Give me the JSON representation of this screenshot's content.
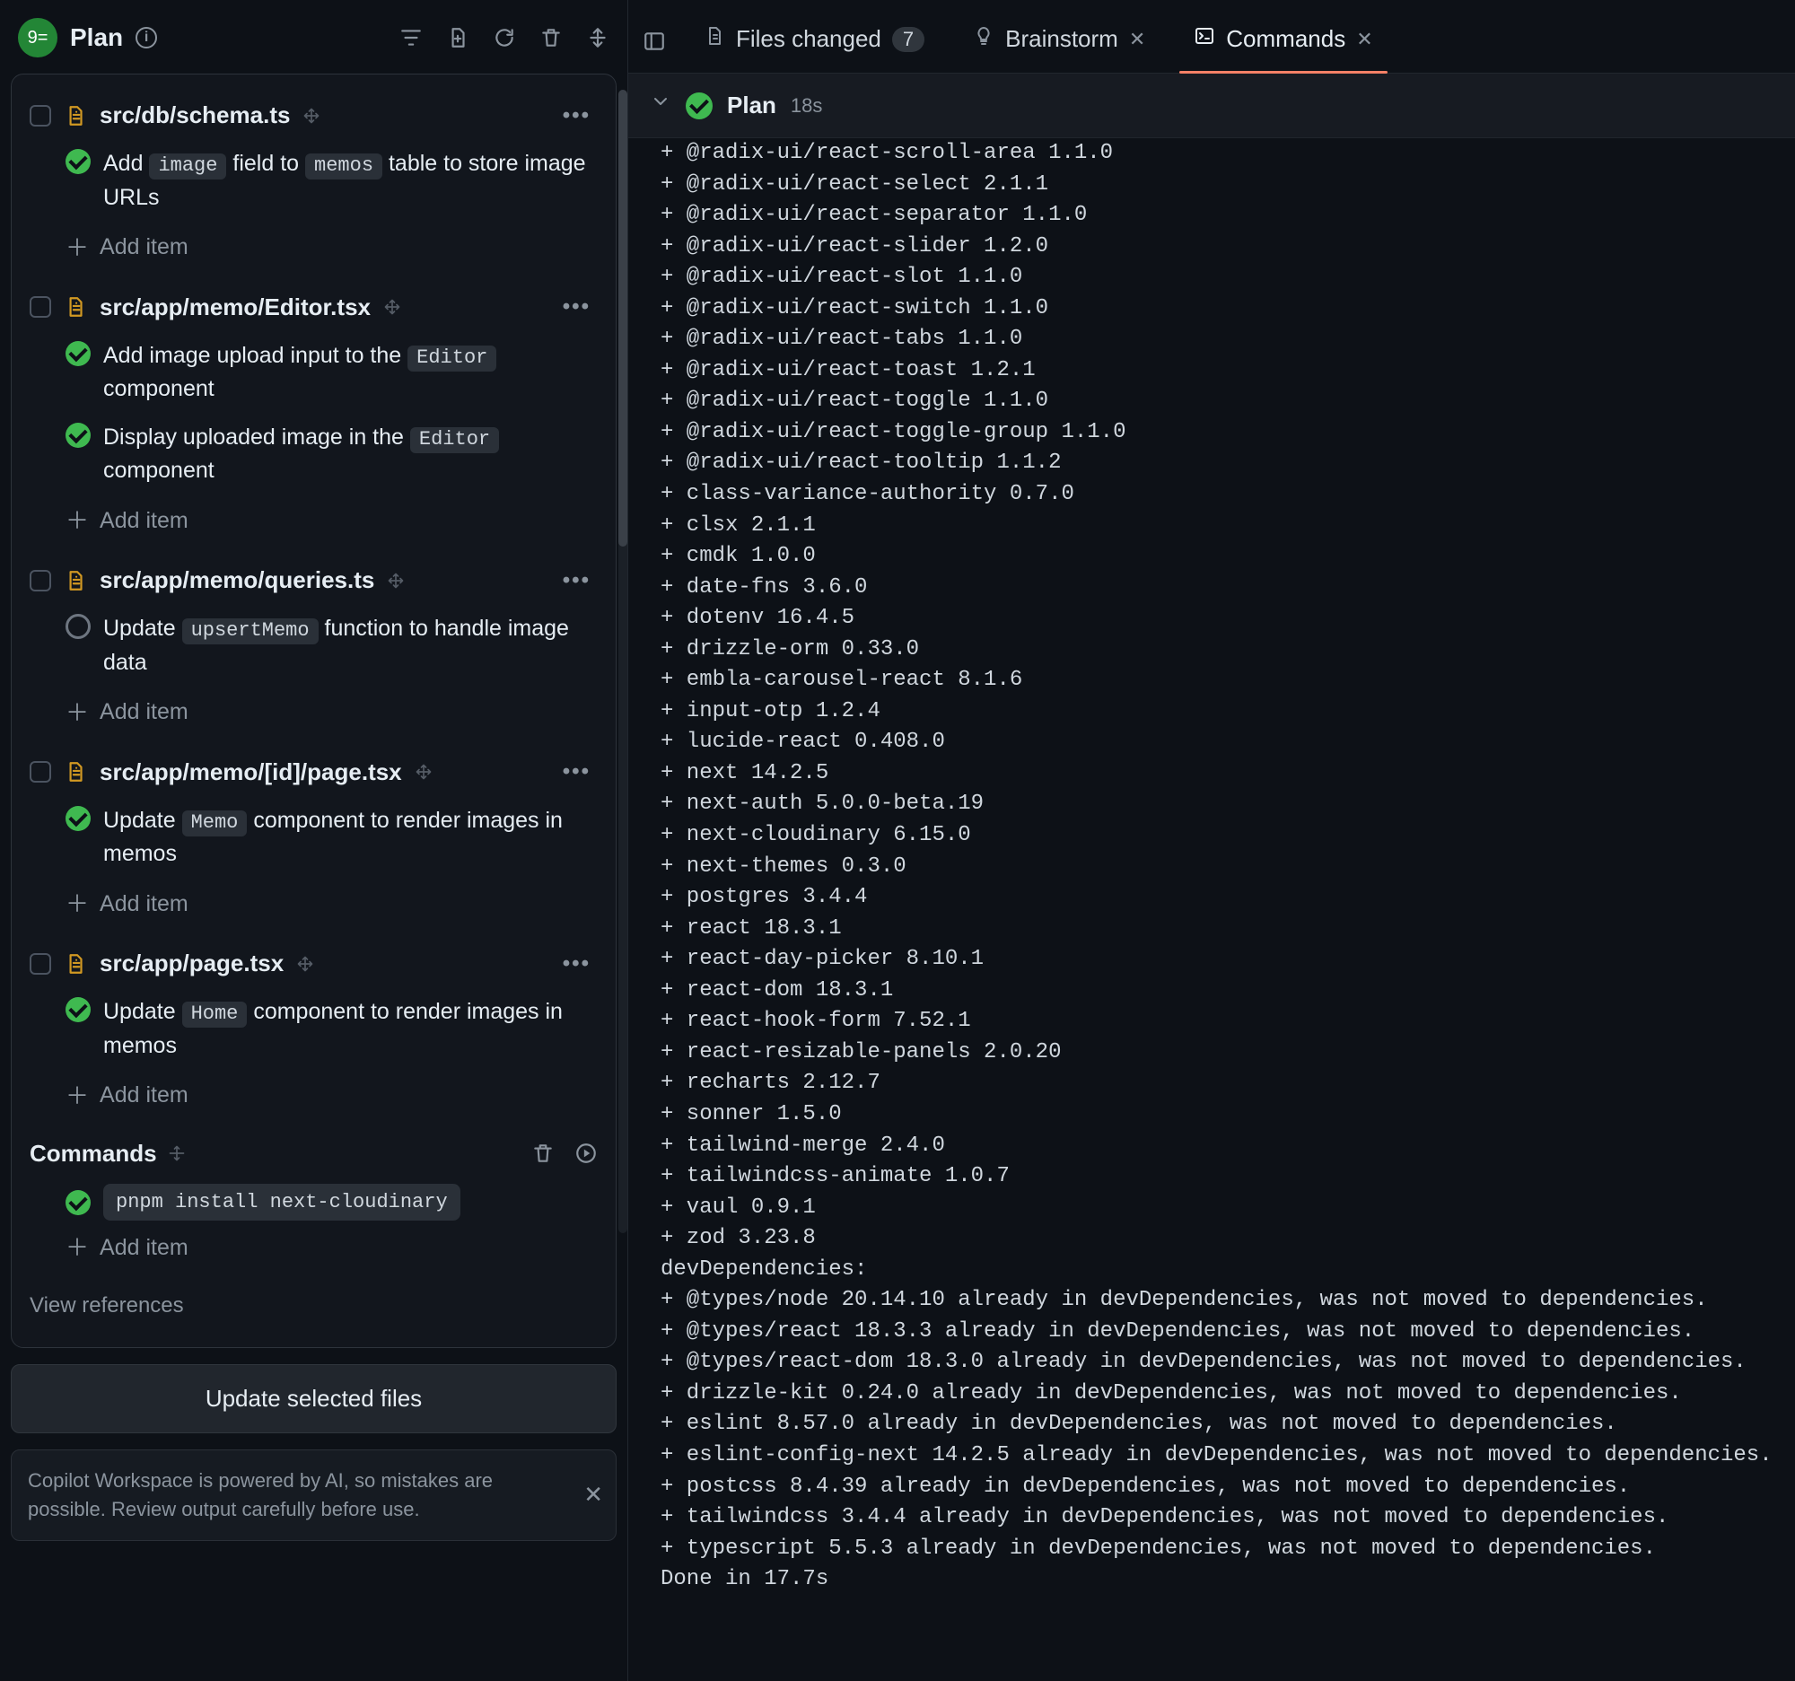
{
  "header": {
    "avatar_text": "9=",
    "title": "Plan"
  },
  "plan": {
    "groups": [
      {
        "path": "src/db/schema.ts",
        "tasks": [
          {
            "status": "done",
            "segments": [
              "Add ",
              {
                "code": "image"
              },
              " field to ",
              {
                "code": "memos"
              },
              " table to store image URLs"
            ]
          }
        ]
      },
      {
        "path": "src/app/memo/Editor.tsx",
        "tasks": [
          {
            "status": "done",
            "segments": [
              "Add image upload input to the ",
              {
                "code": "Editor"
              },
              " component"
            ]
          },
          {
            "status": "done",
            "segments": [
              "Display uploaded image in the ",
              {
                "code": "Editor"
              },
              " component"
            ]
          }
        ]
      },
      {
        "path": "src/app/memo/queries.ts",
        "tasks": [
          {
            "status": "pending",
            "segments": [
              "Update ",
              {
                "code": "upsertMemo"
              },
              " function to handle image data"
            ]
          }
        ]
      },
      {
        "path": "src/app/memo/[id]/page.tsx",
        "tasks": [
          {
            "status": "done",
            "segments": [
              "Update ",
              {
                "code": "Memo"
              },
              " component to render images in memos"
            ]
          }
        ]
      },
      {
        "path": "src/app/page.tsx",
        "tasks": [
          {
            "status": "done",
            "segments": [
              "Update ",
              {
                "code": "Home"
              },
              " component to render images in memos"
            ]
          }
        ]
      }
    ],
    "add_item_label": "Add item",
    "commands": {
      "title": "Commands",
      "items": [
        {
          "status": "done",
          "cmd": "pnpm install next-cloudinary"
        }
      ]
    },
    "view_references": "View references",
    "update_button": "Update selected files"
  },
  "notice": {
    "text": "Copilot Workspace is powered by AI, so mistakes are possible. Review output carefully before use."
  },
  "tabs": {
    "files_changed": {
      "label": "Files changed",
      "count": "7"
    },
    "brainstorm": {
      "label": "Brainstorm"
    },
    "commands": {
      "label": "Commands"
    }
  },
  "subheader": {
    "title": "Plan",
    "time": "18s"
  },
  "terminal_lines": [
    "+ @radix-ui/react-scroll-area 1.1.0",
    "+ @radix-ui/react-select 2.1.1",
    "+ @radix-ui/react-separator 1.1.0",
    "+ @radix-ui/react-slider 1.2.0",
    "+ @radix-ui/react-slot 1.1.0",
    "+ @radix-ui/react-switch 1.1.0",
    "+ @radix-ui/react-tabs 1.1.0",
    "+ @radix-ui/react-toast 1.2.1",
    "+ @radix-ui/react-toggle 1.1.0",
    "+ @radix-ui/react-toggle-group 1.1.0",
    "+ @radix-ui/react-tooltip 1.1.2",
    "+ class-variance-authority 0.7.0",
    "+ clsx 2.1.1",
    "+ cmdk 1.0.0",
    "+ date-fns 3.6.0",
    "+ dotenv 16.4.5",
    "+ drizzle-orm 0.33.0",
    "+ embla-carousel-react 8.1.6",
    "+ input-otp 1.2.4",
    "+ lucide-react 0.408.0",
    "+ next 14.2.5",
    "+ next-auth 5.0.0-beta.19",
    "+ next-cloudinary 6.15.0",
    "+ next-themes 0.3.0",
    "+ postgres 3.4.4",
    "+ react 18.3.1",
    "+ react-day-picker 8.10.1",
    "+ react-dom 18.3.1",
    "+ react-hook-form 7.52.1",
    "+ react-resizable-panels 2.0.20",
    "+ recharts 2.12.7",
    "+ sonner 1.5.0",
    "+ tailwind-merge 2.4.0",
    "+ tailwindcss-animate 1.0.7",
    "+ vaul 0.9.1",
    "+ zod 3.23.8",
    "",
    "devDependencies:",
    "+ @types/node 20.14.10 already in devDependencies, was not moved to dependencies.",
    "+ @types/react 18.3.3 already in devDependencies, was not moved to dependencies.",
    "+ @types/react-dom 18.3.0 already in devDependencies, was not moved to dependencies.",
    "+ drizzle-kit 0.24.0 already in devDependencies, was not moved to dependencies.",
    "+ eslint 8.57.0 already in devDependencies, was not moved to dependencies.",
    "+ eslint-config-next 14.2.5 already in devDependencies, was not moved to dependencies.",
    "+ postcss 8.4.39 already in devDependencies, was not moved to dependencies.",
    "+ tailwindcss 3.4.4 already in devDependencies, was not moved to dependencies.",
    "+ typescript 5.5.3 already in devDependencies, was not moved to dependencies.",
    "",
    "Done in 17.7s"
  ]
}
